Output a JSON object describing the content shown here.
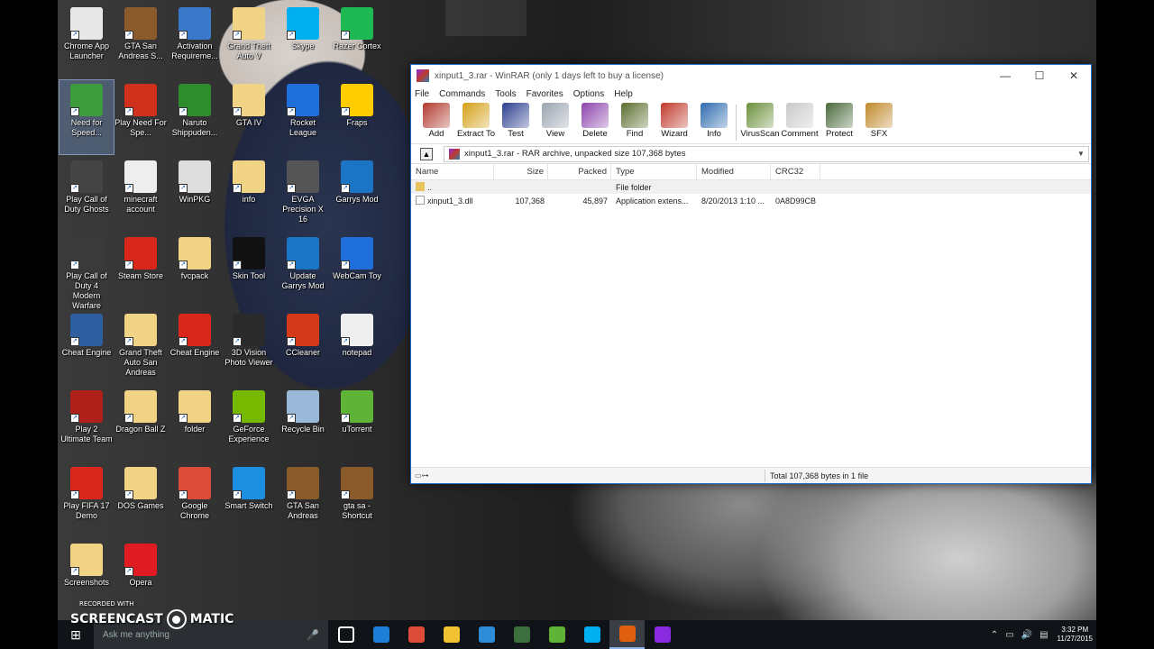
{
  "desktop": {
    "icons": [
      {
        "label": "Chrome App Launcher",
        "color": "#e8e8e8"
      },
      {
        "label": "GTA San Andreas S...",
        "color": "#8b5a2b"
      },
      {
        "label": "Activation Requireme...",
        "color": "#3a78c9"
      },
      {
        "label": "Grand Theft Auto V",
        "color": "#f1d385"
      },
      {
        "label": "Skype",
        "color": "#00aff0"
      },
      {
        "label": "Razer Cortex",
        "color": "#1db954"
      },
      {
        "label": "Need for Speed...",
        "color": "#3d9a3d"
      },
      {
        "label": "Play Need For Spe...",
        "color": "#d1301d"
      },
      {
        "label": "Naruto Shippuden...",
        "color": "#2e8b2e"
      },
      {
        "label": "GTA IV",
        "color": "#f1d385"
      },
      {
        "label": "Rocket League",
        "color": "#1e6fd9"
      },
      {
        "label": "Fraps",
        "color": "#ffcc00"
      },
      {
        "label": "Play Call of Duty Ghosts",
        "color": "#444444"
      },
      {
        "label": "minecraft account",
        "color": "#eeeeee"
      },
      {
        "label": "WinPKG",
        "color": "#dddddd"
      },
      {
        "label": "info",
        "color": "#f1d385"
      },
      {
        "label": "EVGA Precision X 16",
        "color": "#555555"
      },
      {
        "label": "Garrys Mod",
        "color": "#1b74c4"
      },
      {
        "label": "Play Call of Duty 4 Modern Warfare",
        "color": "#3a3a3a"
      },
      {
        "label": "Steam Store",
        "color": "#d9271c"
      },
      {
        "label": "fvcpack",
        "color": "#f1d385"
      },
      {
        "label": "Skin Tool",
        "color": "#111111"
      },
      {
        "label": "Update Garrys Mod",
        "color": "#1b74c4"
      },
      {
        "label": "WebCam Toy",
        "color": "#1e6fd9"
      },
      {
        "label": "Cheat Engine",
        "color": "#2d5fa0"
      },
      {
        "label": "Grand Theft Auto San Andreas",
        "color": "#f1d385"
      },
      {
        "label": "Cheat Engine",
        "color": "#d9271c"
      },
      {
        "label": "3D Vision Photo Viewer",
        "color": "#2a2a2a"
      },
      {
        "label": "CCleaner",
        "color": "#d43a1a"
      },
      {
        "label": "notepad",
        "color": "#eeeeee"
      },
      {
        "label": "Play 2 Ultimate Team",
        "color": "#b0201a"
      },
      {
        "label": "Dragon Ball Z",
        "color": "#f1d385"
      },
      {
        "label": "folder",
        "color": "#f1d385"
      },
      {
        "label": "GeForce Experience",
        "color": "#76b900"
      },
      {
        "label": "Recycle Bin",
        "color": "#9ab8d8"
      },
      {
        "label": "uTorrent",
        "color": "#5fb336"
      },
      {
        "label": "Play FIFA 17 Demo",
        "color": "#d9271c"
      },
      {
        "label": "DOS Games",
        "color": "#f1d385"
      },
      {
        "label": "Google Chrome",
        "color": "#dd4b39"
      },
      {
        "label": "Smart Switch",
        "color": "#1e8fe0"
      },
      {
        "label": "GTA San Andreas",
        "color": "#8b5a2b"
      },
      {
        "label": "gta sa - Shortcut",
        "color": "#8b5a2b"
      },
      {
        "label": "Screenshots",
        "color": "#f1d385"
      },
      {
        "label": "Opera",
        "color": "#e01b22"
      }
    ]
  },
  "window": {
    "title": "xinput1_3.rar - WinRAR (only 1 days left to buy a license)",
    "controls": {
      "minimize": "—",
      "maximize": "☐",
      "close": "✕"
    },
    "menu": [
      "File",
      "Commands",
      "Tools",
      "Favorites",
      "Options",
      "Help"
    ],
    "toolbar": [
      {
        "label": "Add",
        "color": "#b03a2e"
      },
      {
        "label": "Extract To",
        "color": "#d4a017"
      },
      {
        "label": "Test",
        "color": "#2c3e90"
      },
      {
        "label": "View",
        "color": "#9aa4b0"
      },
      {
        "label": "Delete",
        "color": "#8e44ad"
      },
      {
        "label": "Find",
        "color": "#5b6e2e"
      },
      {
        "label": "Wizard",
        "color": "#c0392b"
      },
      {
        "label": "Info",
        "color": "#2e6bb0"
      },
      {
        "label": "VirusScan",
        "color": "#6a8f3a"
      },
      {
        "label": "Comment",
        "color": "#c9c9c9"
      },
      {
        "label": "Protect",
        "color": "#4a6a3a"
      },
      {
        "label": "SFX",
        "color": "#c0892b"
      }
    ],
    "path": "xinput1_3.rar - RAR archive, unpacked size 107,368 bytes",
    "columns": [
      "Name",
      "Size",
      "Packed",
      "Type",
      "Modified",
      "CRC32"
    ],
    "rows": [
      {
        "name": "..",
        "size": "",
        "packed": "",
        "type": "File folder",
        "modified": "",
        "crc": ""
      },
      {
        "name": "xinput1_3.dll",
        "size": "107,368",
        "packed": "45,897",
        "type": "Application extens...",
        "modified": "8/20/2013 1:10 ...",
        "crc": "0A8D99CB"
      }
    ],
    "status": "Total 107,368 bytes in 1 file"
  },
  "taskbar": {
    "search_placeholder": "Ask me anything",
    "apps": [
      {
        "name": "task-view",
        "color": "#ffffff"
      },
      {
        "name": "edge",
        "color": "#1e7fd8"
      },
      {
        "name": "chrome",
        "color": "#dd4b39"
      },
      {
        "name": "file-explorer",
        "color": "#f1c232"
      },
      {
        "name": "rdp",
        "color": "#2e8bd8"
      },
      {
        "name": "vortex",
        "color": "#3d6e3d"
      },
      {
        "name": "utorrent",
        "color": "#5fb336"
      },
      {
        "name": "skype",
        "color": "#00aff0"
      },
      {
        "name": "screencast",
        "color": "#e06010"
      },
      {
        "name": "winrar",
        "color": "#8a2be2"
      }
    ],
    "clock_time": "3:32 PM",
    "clock_date": "11/27/2015"
  },
  "watermark": {
    "small": "RECORDED WITH",
    "left": "SCREENCAST",
    "right": "MATIC"
  }
}
